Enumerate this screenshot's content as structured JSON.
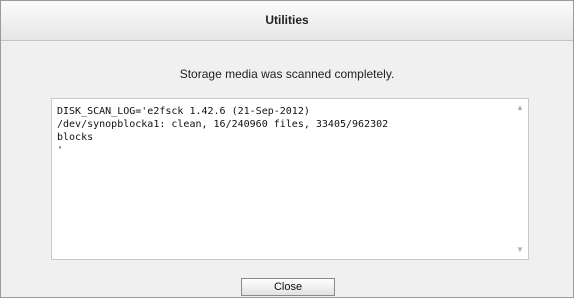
{
  "dialog": {
    "title": "Utilities",
    "message": "Storage media was scanned completely.",
    "log": "DISK_SCAN_LOG='e2fsck 1.42.6 (21-Sep-2012)\n/dev/synopblocka1: clean, 16/240960 files, 33405/962302\nblocks\n'",
    "scroll_up_icon": "▲",
    "scroll_down_icon": "▼",
    "close_label": "Close"
  }
}
